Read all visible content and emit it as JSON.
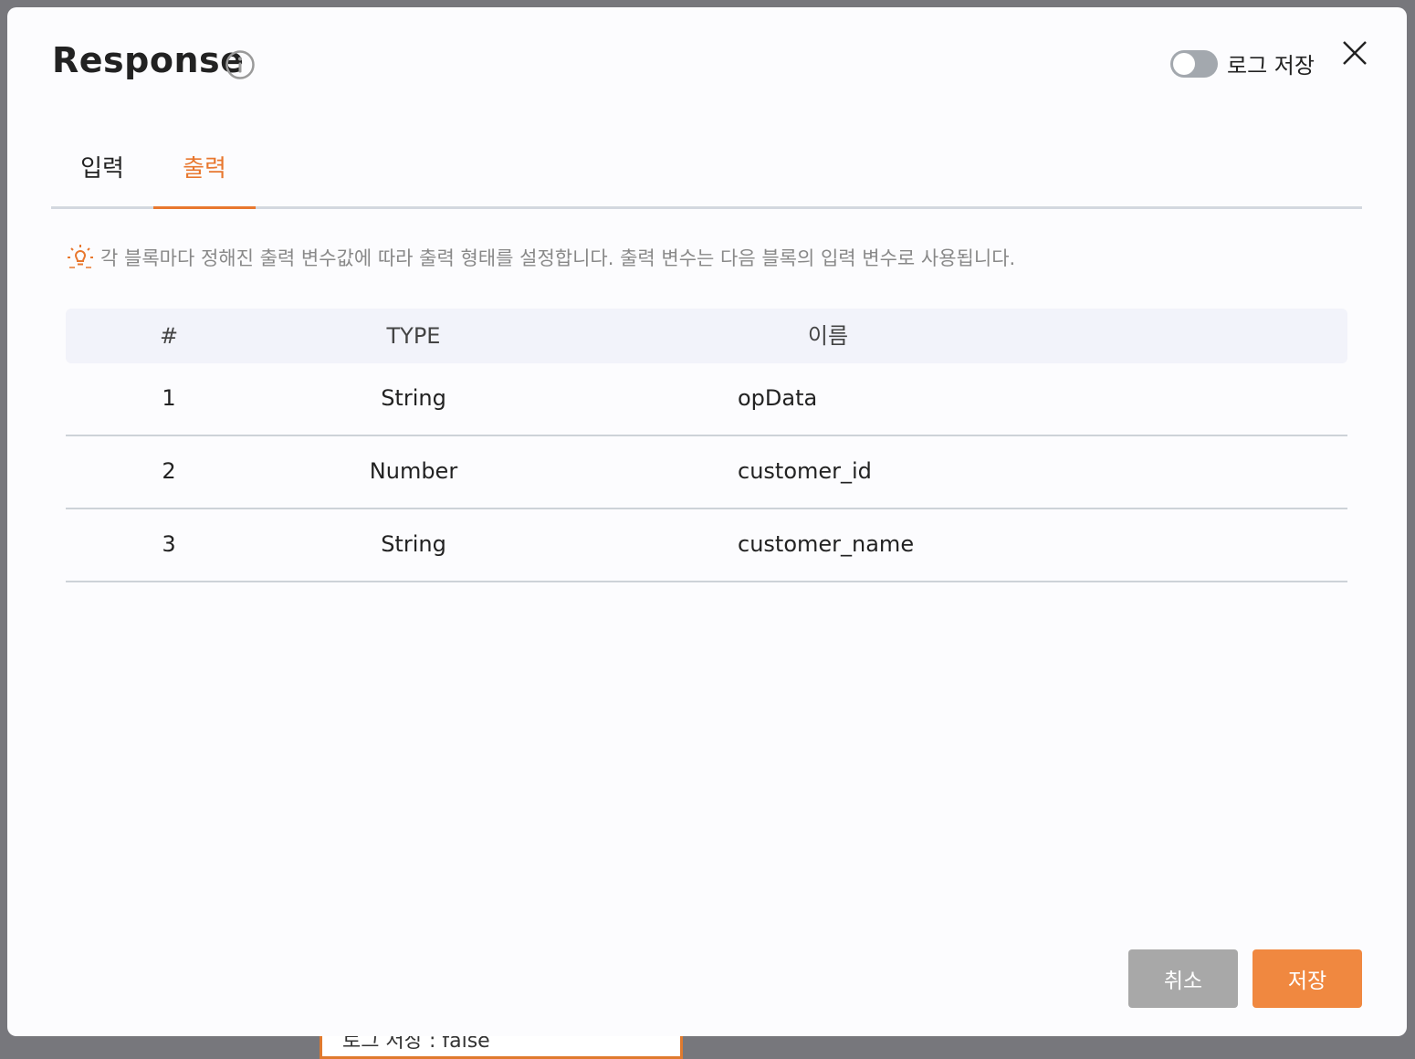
{
  "backdrop": {
    "text": "로그 저장 : false"
  },
  "modal": {
    "title": "Response",
    "log_toggle": {
      "label": "로그 저장",
      "on": false
    }
  },
  "tabs": [
    {
      "label": "입력",
      "active": false
    },
    {
      "label": "출력",
      "active": true
    }
  ],
  "hint": "각 블록마다 정해진 출력 변수값에 따라 출력 형태를 설정합니다. 출력 변수는 다음 블록의 입력 변수로 사용됩니다.",
  "table": {
    "headers": [
      "#",
      "TYPE",
      "이름"
    ],
    "rows": [
      [
        "1",
        "String",
        "opData"
      ],
      [
        "2",
        "Number",
        "customer_id"
      ],
      [
        "3",
        "String",
        "customer_name"
      ]
    ]
  },
  "buttons": {
    "cancel": "취소",
    "save": "저장"
  },
  "colors": {
    "accent": "#e8772e",
    "save_button": "#f08840",
    "cancel_button": "#a8a8a8"
  }
}
